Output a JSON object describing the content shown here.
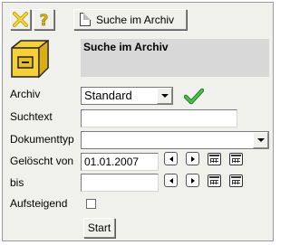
{
  "toolbar": {
    "search_button_label": "Suche im Archiv"
  },
  "header": {
    "title": "Suche im Archiv"
  },
  "form": {
    "archiv": {
      "label": "Archiv",
      "selected": "Standard"
    },
    "suchtext": {
      "label": "Suchtext",
      "value": ""
    },
    "dokumenttyp": {
      "label": "Dokumenttyp",
      "selected": ""
    },
    "geloescht_von": {
      "label": "Gelöscht von",
      "value": "01.01.2007"
    },
    "bis": {
      "label": "bis",
      "value": ""
    },
    "aufsteigend": {
      "label": "Aufsteigend",
      "checked": false
    },
    "start_label": "Start"
  }
}
